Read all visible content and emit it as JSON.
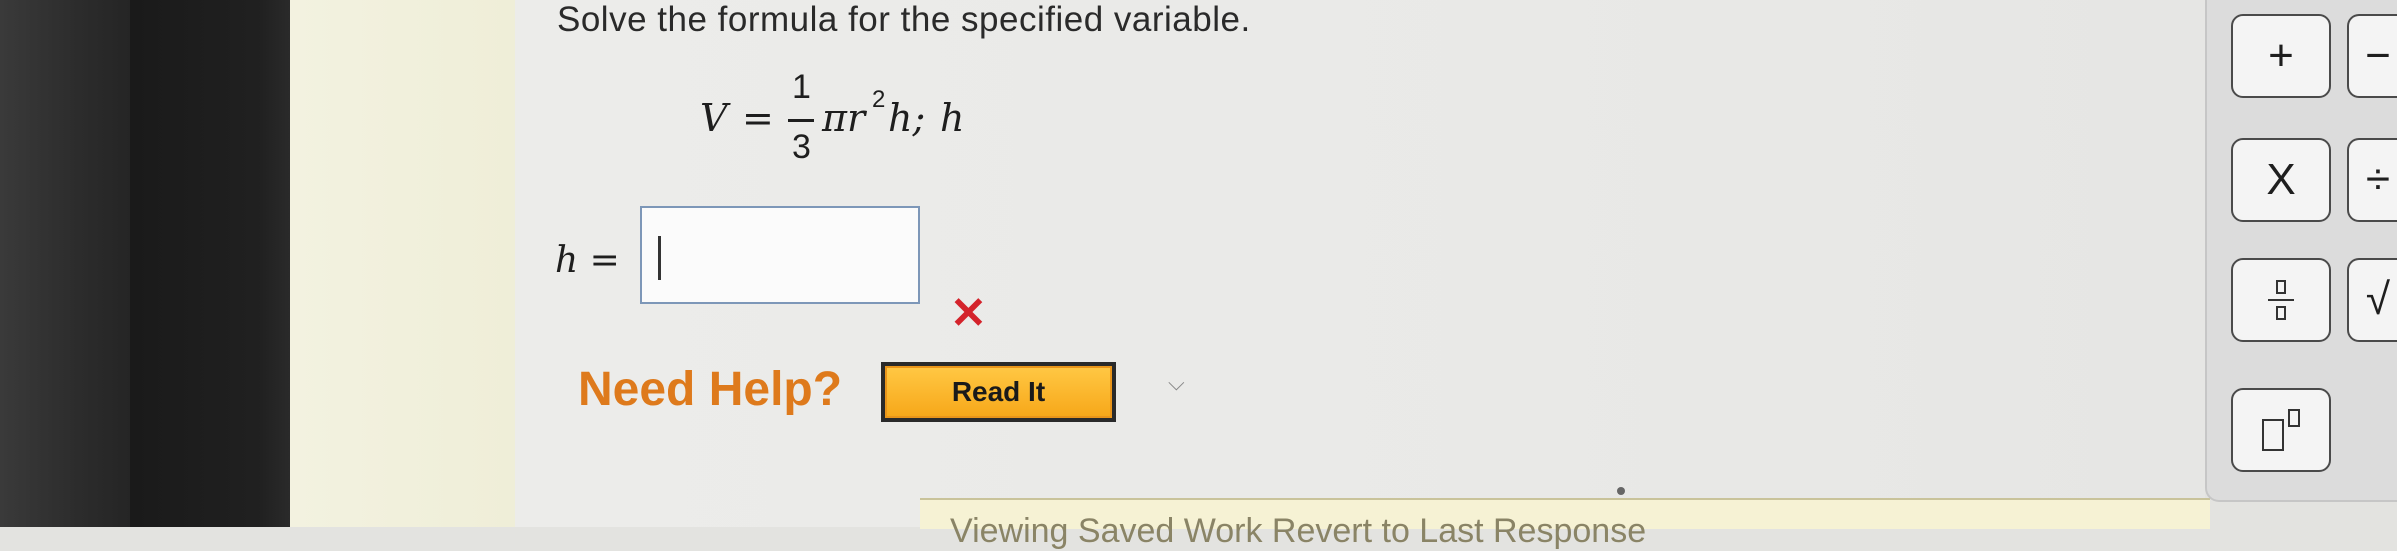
{
  "question": {
    "prompt": "Solve the formula for the specified variable."
  },
  "formula": {
    "lhs": "V",
    "equals": "=",
    "numerator": "1",
    "denominator": "3",
    "body": "πr",
    "exponent": "2",
    "tail": "h;",
    "target_variable": "h"
  },
  "answer": {
    "variable": "h",
    "equals": "=",
    "value": "",
    "status_symbol": "✕"
  },
  "help": {
    "label": "Need Help?",
    "read_it_label": "Read It"
  },
  "footer": {
    "partial_text": "Viewing Saved Work Revert to Last Response"
  },
  "palette": {
    "plus_label": "+",
    "minus_label": "−",
    "times_label": "X",
    "divide_label": "÷",
    "sqrt_label": "√"
  },
  "colors": {
    "help_orange": "#de7a1c",
    "wrong_red": "#d4232b",
    "button_gold": "#f7a81a",
    "input_border": "#7d97b8"
  }
}
